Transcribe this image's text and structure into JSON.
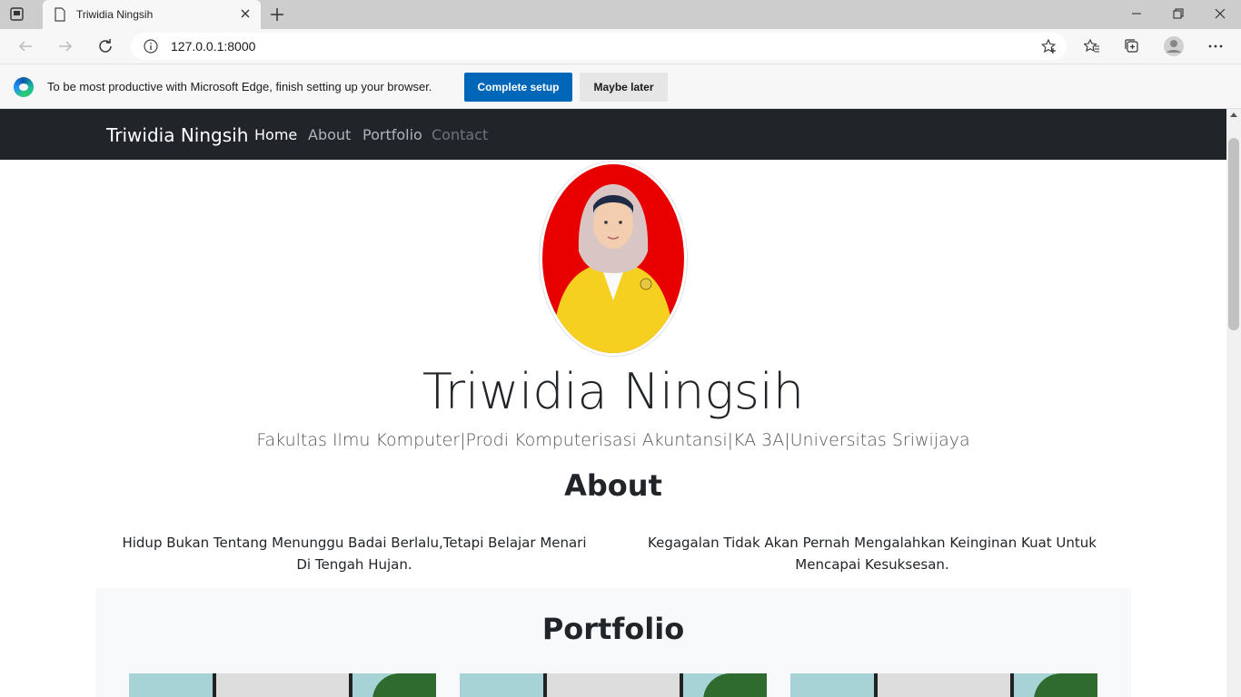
{
  "browser": {
    "tab_title": "Triwidia Ningsih",
    "url": "127.0.0.1:8000",
    "infobar": {
      "message": "To be most productive with Microsoft Edge, finish setting up your browser.",
      "primary_button": "Complete setup",
      "secondary_button": "Maybe later"
    }
  },
  "site": {
    "brand": "Triwidia Ningsih",
    "nav": [
      {
        "label": "Home",
        "color": "#ffffff"
      },
      {
        "label": "About",
        "color": "#adb5bd"
      },
      {
        "label": "Portfolio",
        "color": "#adb5bd"
      },
      {
        "label": "Contact",
        "color": "#6c757d"
      }
    ],
    "hero": {
      "name": "Triwidia Ningsih",
      "subtitle": "Fakultas Ilmu Komputer|Prodi Komputerisasi Akuntansi|KA 3A|Universitas Sriwijaya"
    },
    "about": {
      "title": "About",
      "left": "Hidup Bukan Tentang Menunggu Badai Berlalu,Tetapi Belajar Menari Di Tengah Hujan.",
      "right": "Kegagalan Tidak Akan Pernah Mengalahkan Keinginan Kuat Untuk Mencapai Kesuksesan."
    },
    "portfolio": {
      "title": "Portfolio"
    }
  },
  "colors": {
    "navbar": "#212529",
    "accent": "#0067b8",
    "profile_bg": "#e80000"
  }
}
